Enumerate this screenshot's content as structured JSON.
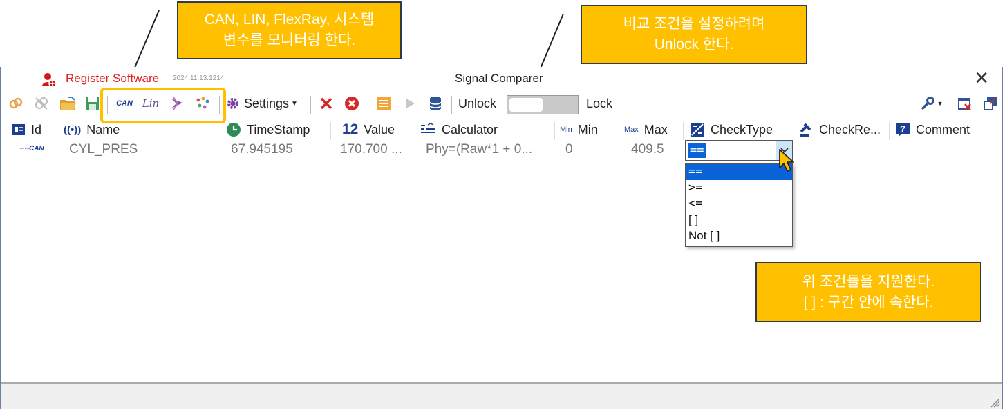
{
  "titlebar": {
    "register_label": "Register Software",
    "version": "2024.11.13.1214",
    "title": "Signal Comparer"
  },
  "toolbar": {
    "settings_label": "Settings",
    "unlock_label": "Unlock",
    "lock_label": "Lock",
    "bus_icons": [
      "CAN",
      "LIN",
      "FlexRay",
      "System Variable"
    ],
    "can_icon_text": "CAN",
    "lin_icon_text": "Lin"
  },
  "grid": {
    "columns": {
      "id": "Id",
      "name": "Name",
      "timestamp": "TimeStamp",
      "value": "Value",
      "value_icon": "12",
      "calculator": "Calculator",
      "min": "Min",
      "min_icon": "Min",
      "max": "Max",
      "max_icon": "Max",
      "checktype": "CheckType",
      "checkresult": "CheckRe...",
      "comment": "Comment"
    },
    "row": {
      "bus": "CAN",
      "name": "CYL_PRES",
      "timestamp": "67.945195",
      "value": "170.700 ...",
      "calculator": "Phy=(Raw*1 + 0...",
      "min": "0",
      "max": "409.5",
      "checktype": "=="
    }
  },
  "dropdown": {
    "options": [
      "==",
      ">=",
      "<=",
      "[ ]",
      "Not [ ]"
    ],
    "selected": "=="
  },
  "callouts": {
    "monitor_line1": "CAN, LIN, FlexRay, 시스템",
    "monitor_line2": "변수를 모니터링 한다.",
    "unlock_line1": "비교 조건을 설정하려며",
    "unlock_line2": "Unlock 한다.",
    "support_line1": "위 조건들을 지원한다.",
    "support_line2": "[ ] : 구간 안에 속한다."
  },
  "colors": {
    "accent_callout": "#ffc000",
    "selection": "#0a64d8",
    "register_red": "#e02020"
  }
}
